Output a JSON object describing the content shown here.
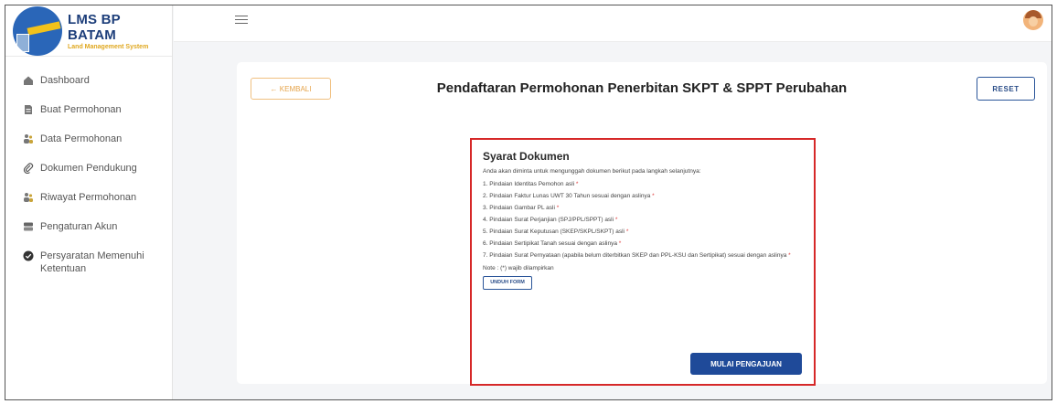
{
  "brand": {
    "title": "LMS BP BATAM",
    "subtitle": "Land Management System"
  },
  "sidebar": {
    "items": [
      {
        "label": "Dashboard",
        "icon": "home-icon"
      },
      {
        "label": "Buat Permohonan",
        "icon": "document-icon"
      },
      {
        "label": "Data Permohonan",
        "icon": "users-icon"
      },
      {
        "label": "Dokumen Pendukung",
        "icon": "paperclip-icon"
      },
      {
        "label": "Riwayat Permohonan",
        "icon": "history-users-icon"
      },
      {
        "label": "Pengaturan Akun",
        "icon": "account-settings-icon"
      },
      {
        "label": "Persyaratan Memenuhi Ketentuan",
        "icon": "check-circle-icon"
      }
    ]
  },
  "header": {
    "menu_icon": "hamburger-icon",
    "avatar_icon": "user-avatar-icon"
  },
  "main": {
    "back_label": "← KEMBALI",
    "title": "Pendaftaran Permohonan Penerbitan SKPT & SPPT Perubahan",
    "reset_label": "RESET"
  },
  "documents": {
    "title": "Syarat Dokumen",
    "intro": "Anda akan diminta untuk mengunggah dokumen berikut pada langkah selanjutnya:",
    "items": [
      "1. Pindaian Identitas Pemohon asli",
      "2. Pindaian Faktur Lunas UWT 30 Tahun sesuai dengan aslinya",
      "3. Pindaian Gambar PL asli",
      "4. Pindaian Surat Perjanjian (SPJ/PPL/SPPT) asli",
      "5. Pindaian Surat Keputusan (SKEP/SKPL/SKPT) asli",
      "6. Pindaian Sertipikat Tanah sesuai dengan aslinya",
      "7. Pindaian Surat Pernyataan (apabila belum diterbitkan SKEP dan PPL-KSU dan Sertipikat) sesuai dengan aslinya"
    ],
    "required_mark": "*",
    "note": "Note : (*) wajib dilampirkan",
    "download_label": "UNDUH FORM",
    "submit_label": "MULAI PENGAJUAN"
  },
  "colors": {
    "primary": "#1f4a99",
    "accent": "#e5a34a",
    "highlight_border": "#d62828",
    "required": "#e04040"
  }
}
